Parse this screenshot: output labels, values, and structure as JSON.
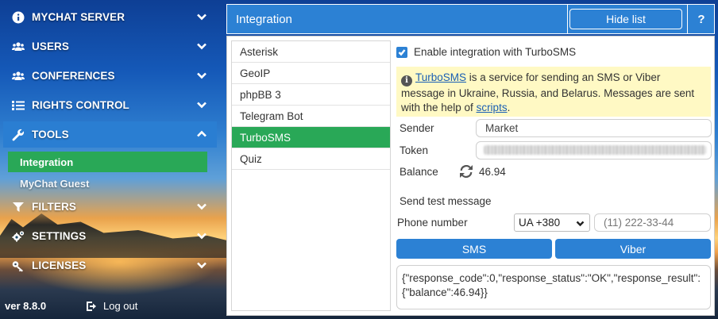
{
  "sidebar": {
    "items": [
      {
        "label": "MYCHAT SERVER",
        "icon": "info-circle-icon"
      },
      {
        "label": "USERS",
        "icon": "users-icon"
      },
      {
        "label": "CONFERENCES",
        "icon": "conferences-icon"
      },
      {
        "label": "RIGHTS CONTROL",
        "icon": "list-icon"
      },
      {
        "label": "TOOLS",
        "icon": "wrench-icon"
      },
      {
        "label": "FILTERS",
        "icon": "filter-icon"
      },
      {
        "label": "SETTINGS",
        "icon": "gears-icon"
      },
      {
        "label": "LICENSES",
        "icon": "key-icon"
      }
    ],
    "tools_sub": [
      {
        "label": "Integration"
      },
      {
        "label": "MyChat Guest"
      }
    ],
    "version": "ver 8.8.0",
    "logout_label": "Log out"
  },
  "header": {
    "title": "Integration",
    "hide_list_label": "Hide list",
    "help_label": "?"
  },
  "integrations": [
    "Asterisk",
    "GeoIP",
    "phpBB 3",
    "Telegram Bot",
    "TurboSMS",
    "Quiz"
  ],
  "selected_integration": "TurboSMS",
  "turbosms": {
    "enable_label": "Enable integration with TurboSMS",
    "enabled": true,
    "info_link": "TurboSMS",
    "info_text": " is a service for sending an SMS or Viber message in Ukraine, Russia, and Belarus. Messages are sent with the help of ",
    "info_link2": "scripts",
    "info_end": ".",
    "sender_label": "Sender",
    "sender_value": "Market",
    "token_label": "Token",
    "balance_label": "Balance",
    "balance_value": "46.94",
    "test_heading": "Send test message",
    "phone_label": "Phone number",
    "country_code": "UA +380",
    "phone_placeholder": "(11) 222-33-44",
    "sms_button": "SMS",
    "viber_button": "Viber",
    "response": "{\"response_code\":0,\"response_status\":\"OK\",\"response_result\":{\"balance\":46.94}}"
  },
  "colors": {
    "accent": "#2c81d4",
    "selected": "#29a857",
    "info_bg": "#fff9c4"
  }
}
